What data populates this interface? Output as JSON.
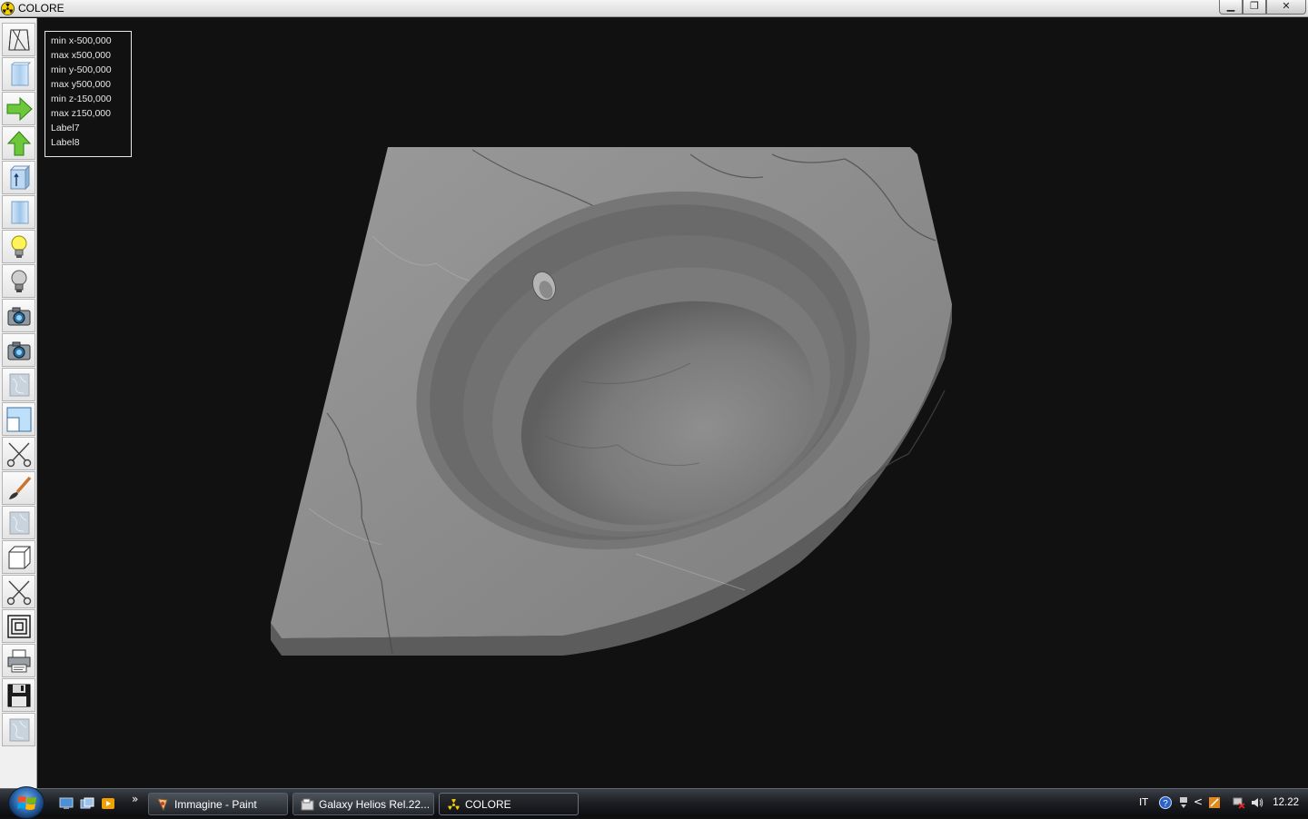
{
  "window": {
    "title": "COLORE",
    "minimize_symbol": "▁",
    "restore_symbol": "❐",
    "close_symbol": "✕"
  },
  "toolbar": {
    "tools": [
      {
        "icon": "wireframe-icon"
      },
      {
        "icon": "solid-block-icon"
      },
      {
        "icon": "arrow-right-icon"
      },
      {
        "icon": "arrow-up-icon"
      },
      {
        "icon": "extrude-block-icon"
      },
      {
        "icon": "cylinder-block-icon"
      },
      {
        "icon": "light-on-icon"
      },
      {
        "icon": "light-off-icon"
      },
      {
        "icon": "camera-icon"
      },
      {
        "icon": "camera-alt-icon"
      },
      {
        "icon": "texture-marble-icon"
      },
      {
        "icon": "view-frame-icon"
      },
      {
        "icon": "scissors-icon"
      },
      {
        "icon": "paint-brush-icon"
      },
      {
        "icon": "texture-marble-alt-icon"
      },
      {
        "icon": "cube-icon"
      },
      {
        "icon": "scissors-alt-icon"
      },
      {
        "icon": "concentric-squares-icon"
      },
      {
        "icon": "printer-icon"
      },
      {
        "icon": "floppy-save-icon"
      },
      {
        "icon": "texture-marble-third-icon"
      }
    ]
  },
  "info": {
    "lines": [
      "min x-500,000",
      "max x500,000",
      "min y-500,000",
      "max y500,000",
      "min z-150,000",
      "max z150,000",
      "Label7",
      "Label8"
    ]
  },
  "taskbar": {
    "overflow": "»",
    "tasks": [
      {
        "label": "Immagine - Paint"
      },
      {
        "label": "Galaxy Helios  Rel.22..."
      },
      {
        "label": "COLORE"
      }
    ],
    "language": "IT",
    "clock": "12.22",
    "tray_chevron": "<"
  },
  "colors": {
    "viewport_bg": "#111111",
    "marble": "#8a8a8a",
    "toolbar_bg": "#f0f0f0"
  }
}
